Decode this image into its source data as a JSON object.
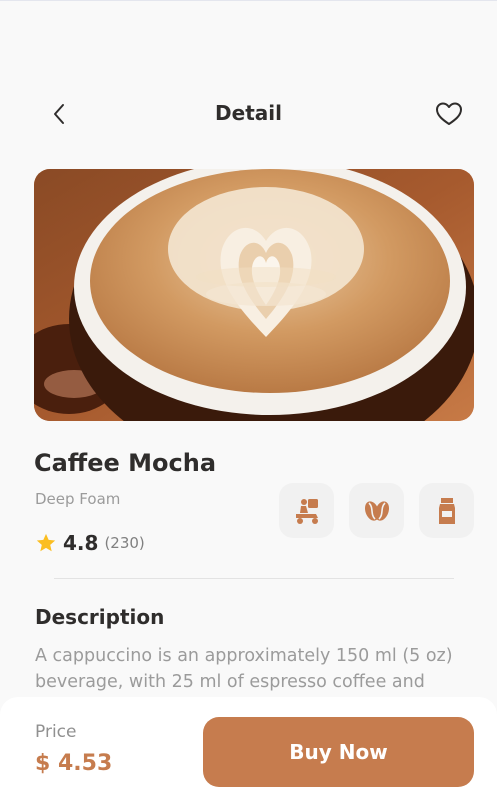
{
  "header": {
    "title": "Detail",
    "back_icon": "chevron-left-icon",
    "favorite_icon": "heart-outline-icon"
  },
  "product": {
    "name": "Caffee Mocha",
    "subtitle": "Deep Foam",
    "rating": "4.8",
    "rating_count": "(230)",
    "image_icon": "latte-art-photo"
  },
  "features": [
    {
      "icon": "delivery-scooter-icon"
    },
    {
      "icon": "coffee-bean-icon"
    },
    {
      "icon": "milk-carton-icon"
    }
  ],
  "description": {
    "title": "Description",
    "text": "A cappuccino is an approximately 150 ml (5 oz) beverage, with 25 ml of espresso coffee and"
  },
  "purchase": {
    "price_label": "Price",
    "price_value": "$ 4.53",
    "buy_label": "Buy Now"
  },
  "colors": {
    "accent": "#C67C4E",
    "star": "#FBBE21",
    "text": "#2F2D2C",
    "muted": "#9B9B9B"
  }
}
